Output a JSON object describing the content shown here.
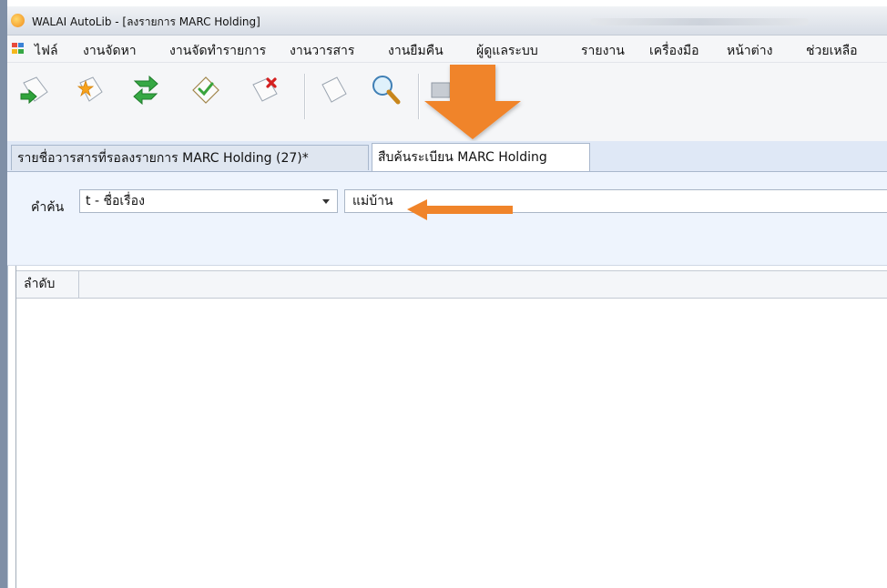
{
  "window": {
    "title": "WALAI AutoLib - [ลงรายการ MARC Holding]"
  },
  "menu": {
    "items": [
      "ไฟล์",
      "งานจัดหา",
      "งานจัดทำรายการ",
      "งานวารสาร",
      "งานยืมคืน",
      "ผู้ดูแลระบบ",
      "รายงาน",
      "เครื่องมือ",
      "หน้าต่าง",
      "ช่วยเหลือ"
    ]
  },
  "toolbar": {
    "icons": [
      "green-arrow-doc-icon",
      "star-doc-icon",
      "green-swap-icon",
      "check-doc-icon",
      "delete-doc-icon",
      "blank-doc-icon",
      "magnifier-icon",
      "partial-tool-icon"
    ]
  },
  "tabs": [
    {
      "label": "รายชื่อวารสารที่รอลงรายการ MARC Holding (27)*",
      "active": false
    },
    {
      "label": "สืบค้นระเบียน MARC Holding",
      "active": true
    }
  ],
  "search": {
    "label": "คำค้น",
    "field_selected": "t - ชื่อเรื่อง",
    "query_value": "แม่บ้าน"
  },
  "grid": {
    "columns": [
      "ลำดับ"
    ]
  },
  "colors": {
    "annotation_arrow": "#f0842a",
    "panel_bg": "#eef4fd",
    "tab_strip_bg": "#dfe8f6"
  }
}
